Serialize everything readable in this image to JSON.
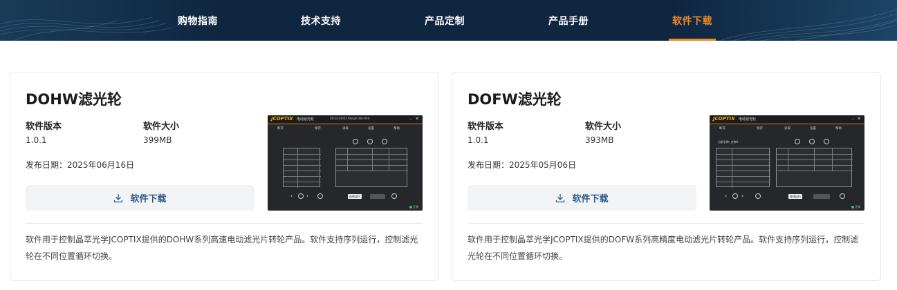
{
  "nav": {
    "items": [
      {
        "label": "购物指南"
      },
      {
        "label": "技术支持"
      },
      {
        "label": "产品定制"
      },
      {
        "label": "产品手册"
      },
      {
        "label": "软件下载"
      }
    ],
    "active_index": 4,
    "colors": {
      "background": "#0e2338",
      "active": "#f08a24"
    }
  },
  "cards": [
    {
      "title": "DOHW滤光轮",
      "version_label": "软件版本",
      "version": "1.0.1",
      "size_label": "软件大小",
      "size": "399MB",
      "date": "发布日期：2025年06月16日",
      "download_label": "软件下载",
      "description": "软件用于控制晶萃光学JCOPTIX提供的DOHW系列高速电动滤光片转轮产品。软件支持序列运行，控制滤光轮在不同位置循环切换。",
      "shot": {
        "logo": "JCOPTIX",
        "app_name": "电动滤光轮",
        "subtitle": "SN:1K10002 Weight 80+W-6",
        "menu": [
          "断开",
          "保存",
          "读取",
          "设置",
          "帮助"
        ],
        "loop_label": "连续运行",
        "status": "正常"
      }
    },
    {
      "title": "DOFW滤光轮",
      "version_label": "软件版本",
      "version": "1.0.1",
      "size_label": "软件大小",
      "size": "393MB",
      "date": "发布日期：2025年05月06日",
      "download_label": "软件下载",
      "description": "软件用于控制晶萃光学JCOPTIX提供的DOFW系列高精度电动滤光片转轮产品。软件支持序列运行，控制滤光轮在不同位置循环切换。",
      "shot": {
        "logo": "JCOPTIX",
        "app_name": "电动滤光轮",
        "subtitle": "",
        "menu": [
          "断开",
          "保存",
          "读取",
          "设置",
          "帮助"
        ],
        "side_label": "当前名称: 名称A",
        "loop_label": "连续运行",
        "status": "正常"
      }
    }
  ]
}
